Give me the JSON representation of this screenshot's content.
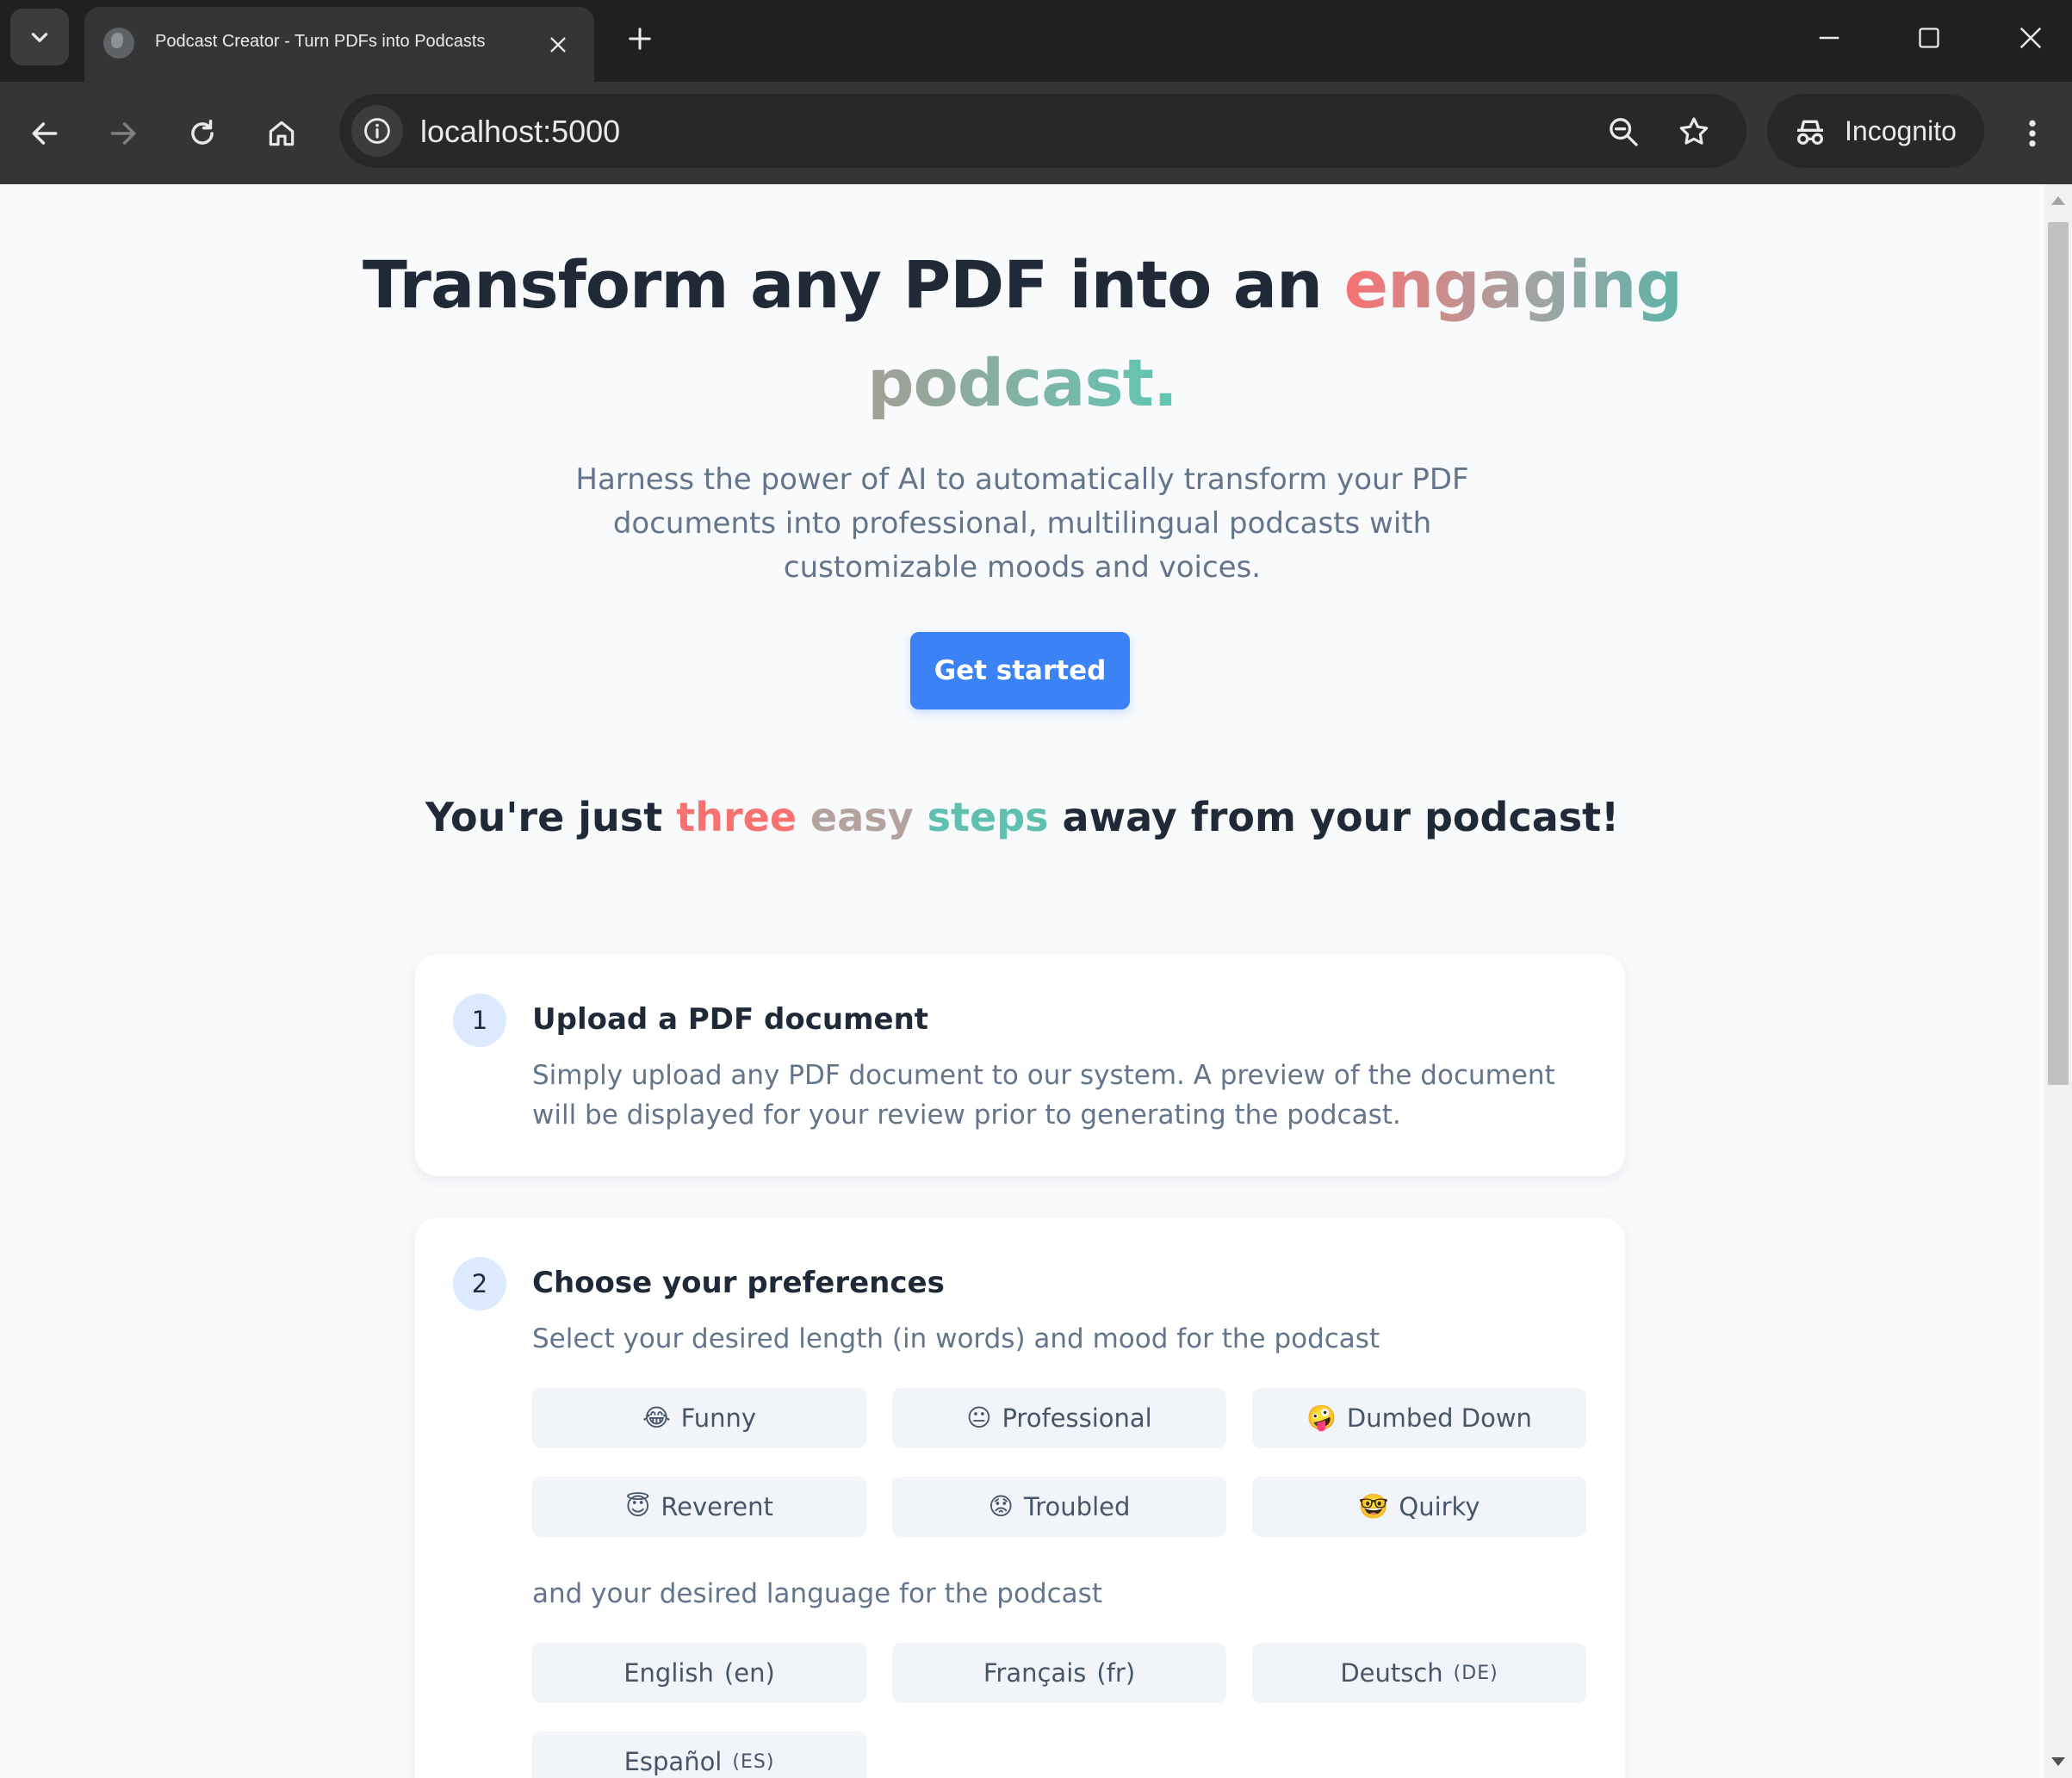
{
  "browser": {
    "tab_title": "Podcast Creator - Turn PDFs into Podcasts",
    "url": "localhost:5000",
    "profile_label": "Incognito"
  },
  "hero": {
    "title_part1": "Transform any PDF into an ",
    "title_highlight1": "engaging",
    "title_highlight2": "podcast.",
    "subtitle": "Harness the power of AI to automatically transform your PDF documents into professional, multilingual podcasts with customizable moods and voices.",
    "cta_label": "Get started"
  },
  "steps_heading": {
    "part1": "You're just ",
    "word1": "three",
    "word2": "easy",
    "word3": "steps",
    "part2": " away from your podcast!"
  },
  "step1": {
    "number": "1",
    "title": "Upload a PDF document",
    "description": "Simply upload any PDF document to our system. A preview of the document will be displayed for your review prior to generating the podcast."
  },
  "step2": {
    "number": "2",
    "title": "Choose your preferences",
    "mood_label": "Select your desired length (in words) and mood for the podcast",
    "moods": [
      {
        "emoji": "😂",
        "label": "Funny"
      },
      {
        "emoji": "😐",
        "label": "Professional"
      },
      {
        "emoji": "🤪",
        "label": "Dumbed Down"
      },
      {
        "emoji": "😇",
        "label": "Reverent"
      },
      {
        "emoji": "😟",
        "label": "Troubled"
      },
      {
        "emoji": "🤓",
        "label": "Quirky"
      }
    ],
    "language_label": "and your desired language for the podcast",
    "languages": [
      {
        "name": "English",
        "code": "(en)"
      },
      {
        "name": "Français",
        "code": "(fr)"
      },
      {
        "name": "Deutsch",
        "code": "(DE)"
      },
      {
        "name": "Español",
        "code": "(ES)"
      }
    ]
  },
  "colors": {
    "accent_blue": "#3b82f6",
    "highlight_red": "#f87171",
    "highlight_teal": "#5fc0b0",
    "heading": "#1f2937",
    "muted_text": "#64748b"
  }
}
